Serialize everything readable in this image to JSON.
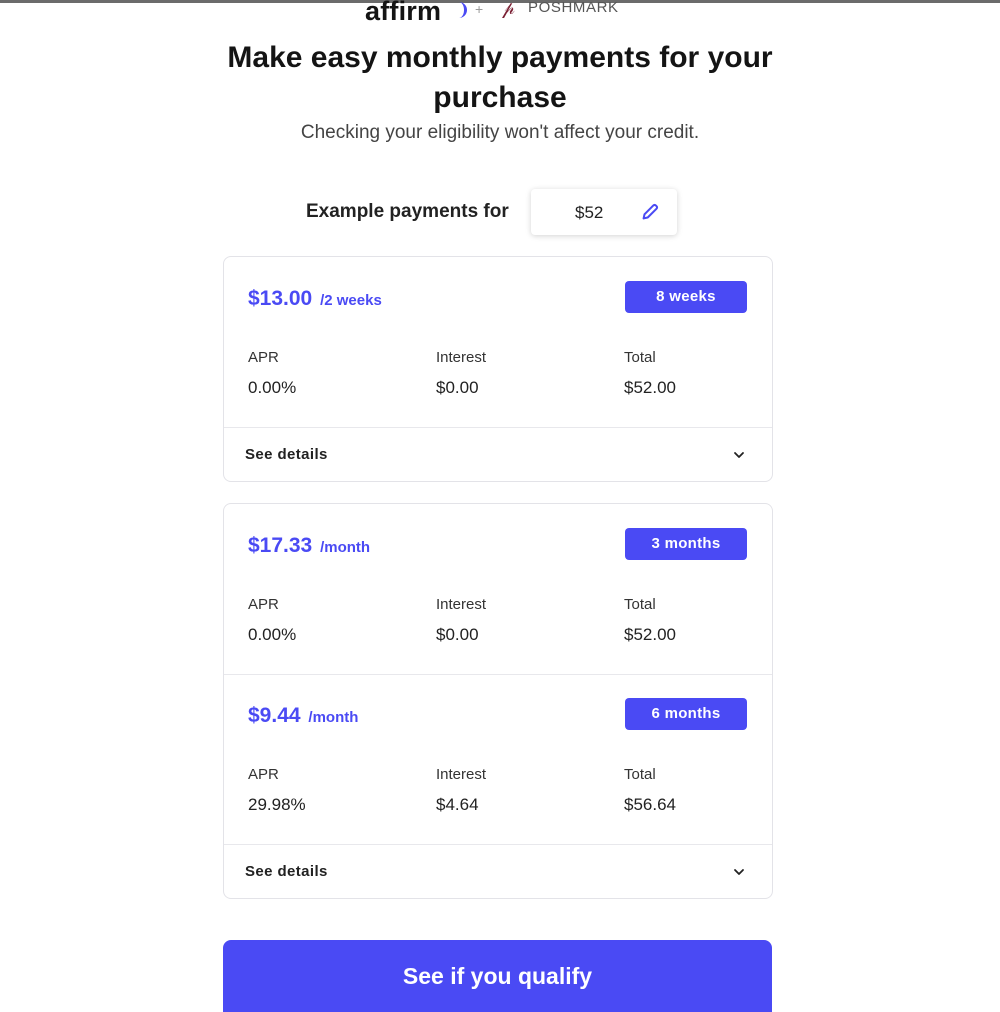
{
  "brand": {
    "affirm_logo": "affirm",
    "plus": "+",
    "partner_logo": "POSHMARK"
  },
  "header": {
    "title": "Make easy monthly payments for your purchase",
    "subtitle": "Checking your eligibility won't affect your credit."
  },
  "example": {
    "label": "Example payments for",
    "amount": "$52"
  },
  "plans": [
    {
      "price": "$13.00",
      "period": "/2 weeks",
      "term": "8 weeks",
      "apr_label": "APR",
      "apr": "0.00%",
      "interest_label": "Interest",
      "interest": "$0.00",
      "total_label": "Total",
      "total": "$52.00"
    },
    {
      "price": "$17.33",
      "period": "/month",
      "term": "3 months",
      "apr_label": "APR",
      "apr": "0.00%",
      "interest_label": "Interest",
      "interest": "$0.00",
      "total_label": "Total",
      "total": "$52.00"
    },
    {
      "price": "$9.44",
      "period": "/month",
      "term": "6 months",
      "apr_label": "APR",
      "apr": "29.98%",
      "interest_label": "Interest",
      "interest": "$4.64",
      "total_label": "Total",
      "total": "$56.64"
    }
  ],
  "details": {
    "label": "See details"
  },
  "cta": {
    "label": "See if you qualify"
  },
  "colors": {
    "accent": "#4a4af4",
    "text": "#141414",
    "border": "#e3e3e8"
  }
}
